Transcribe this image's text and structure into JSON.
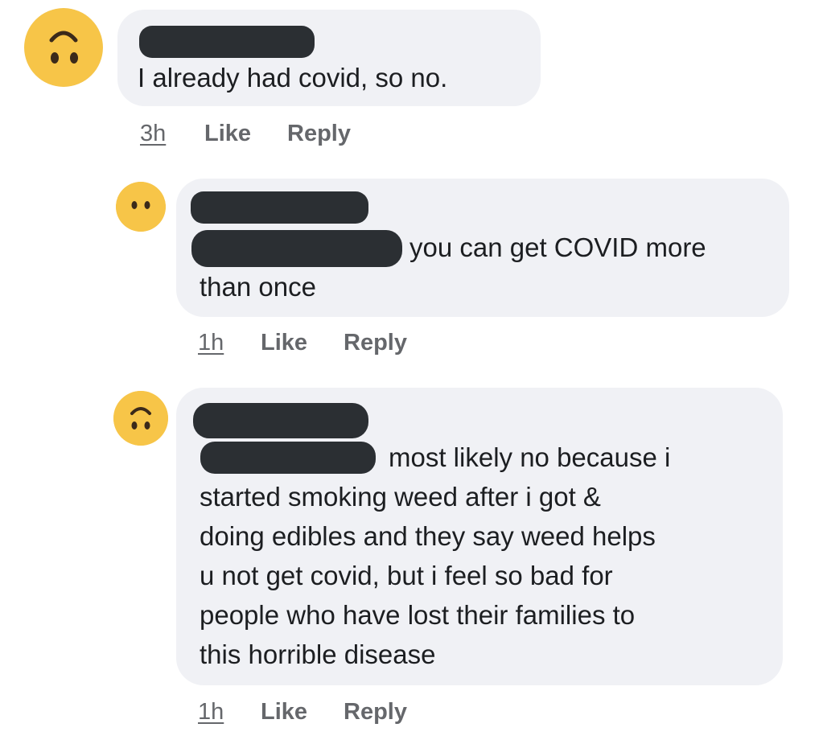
{
  "comments": [
    {
      "author_redacted": true,
      "avatar_icon": "upside-down-face-icon",
      "text": "I already had covid, so no.",
      "time": "3h",
      "like_label": "Like",
      "reply_label": "Reply"
    },
    {
      "author_redacted": true,
      "avatar_icon": "neutral-face-icon",
      "mention_redacted": true,
      "text_line1": "you can get COVID more",
      "text_line2": "than once",
      "time": "1h",
      "like_label": "Like",
      "reply_label": "Reply"
    },
    {
      "author_redacted": true,
      "avatar_icon": "upside-down-face-icon",
      "mention_redacted": true,
      "text_line1": "most likely no because i",
      "text_line2": "started smoking weed after i got &",
      "text_line3": "doing edibles and they say weed helps",
      "text_line4": "u not get covid, but i feel so bad for",
      "text_line5": "people who have lost their families to",
      "text_line6": "this horrible disease",
      "time": "1h",
      "like_label": "Like",
      "reply_label": "Reply"
    }
  ],
  "colors": {
    "bubble": "#f0f1f5",
    "redaction": "#2b2f33",
    "meta": "#65676b",
    "avatar": "#f7c548"
  }
}
